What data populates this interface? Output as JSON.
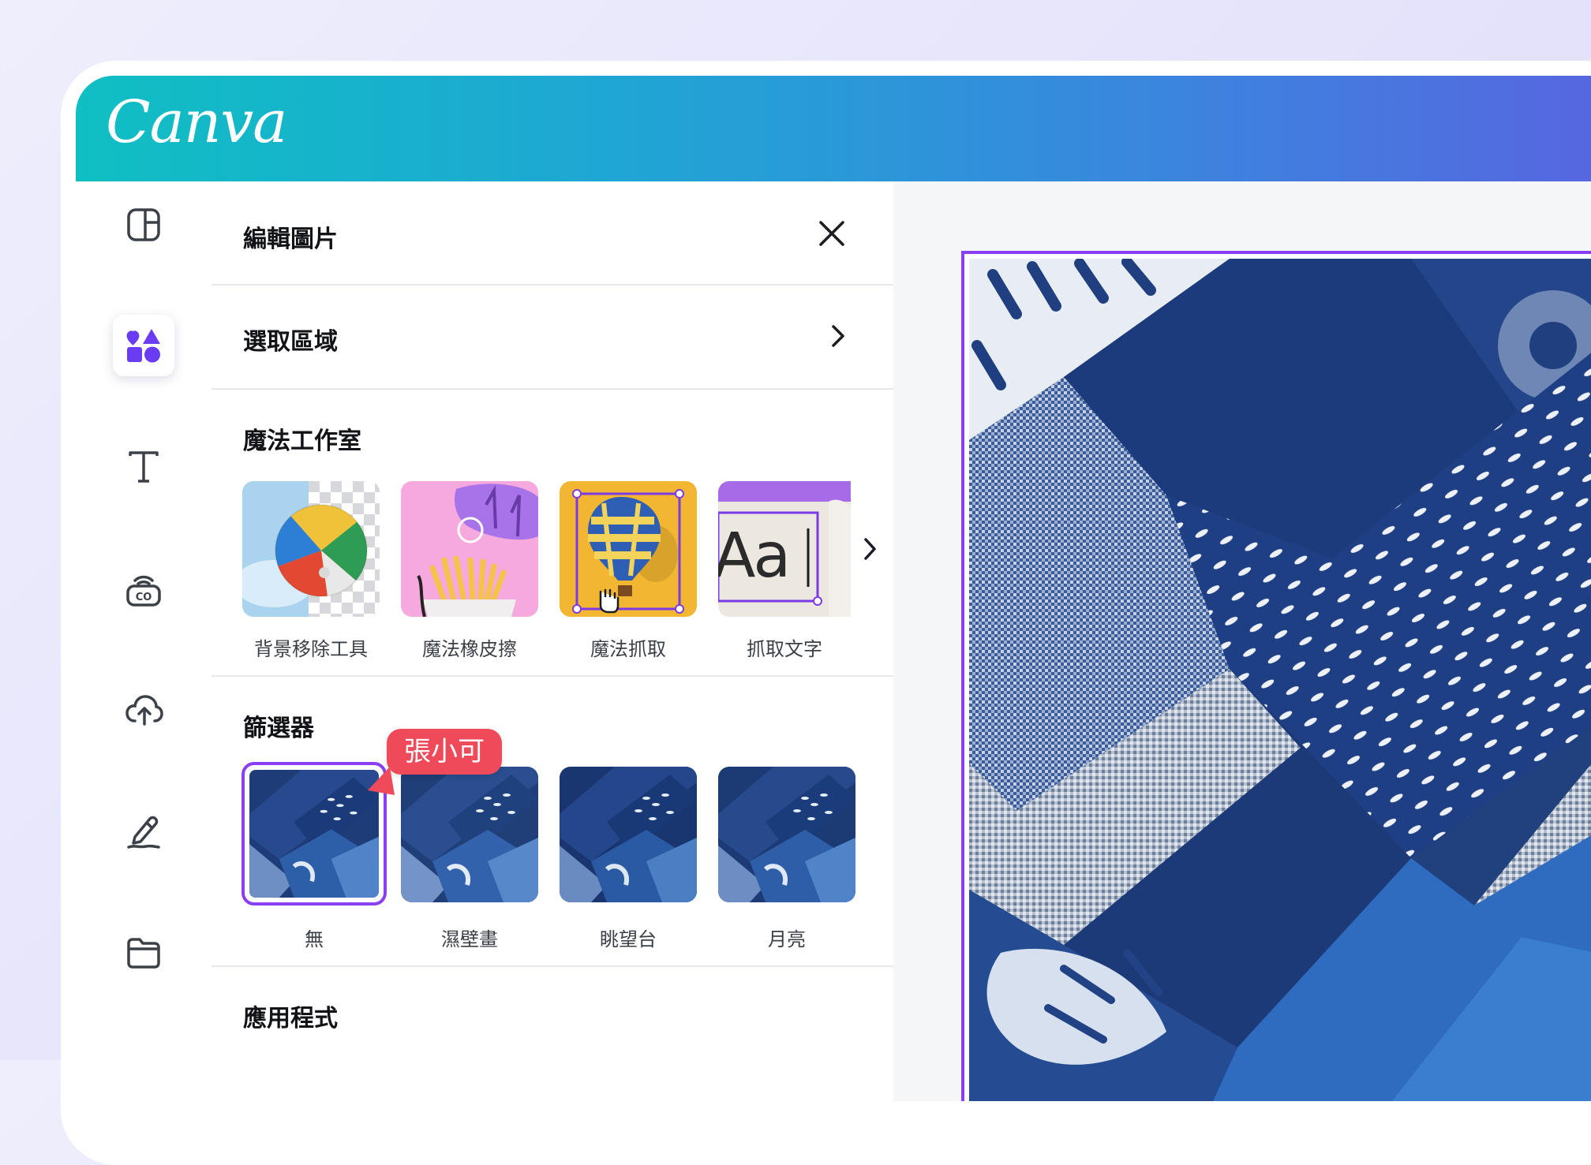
{
  "app": {
    "logo": "Canva"
  },
  "panel": {
    "header_title": "編輯圖片",
    "select_area_label": "選取區域",
    "magic_studio": {
      "title": "魔法工作室",
      "tools": [
        {
          "label": "背景移除工具",
          "icon": "beach-ball-icon"
        },
        {
          "label": "魔法橡皮擦",
          "icon": "fries-icon"
        },
        {
          "label": "魔法抓取",
          "icon": "hot-air-balloon-icon"
        },
        {
          "label": "抓取文字",
          "icon": "text-grab-icon",
          "preview_text": "Aa"
        }
      ]
    },
    "filters": {
      "title": "篩選器",
      "items": [
        {
          "label": "無",
          "selected": true
        },
        {
          "label": "濕壁畫"
        },
        {
          "label": "眺望台"
        },
        {
          "label": "月亮"
        }
      ],
      "collaborator_tag": "張小可"
    },
    "apps_title": "應用程式"
  },
  "sidebar": {
    "items": [
      {
        "icon": "layout-icon"
      },
      {
        "icon": "elements-icon",
        "active": true
      },
      {
        "icon": "text-icon"
      },
      {
        "icon": "brand-icon"
      },
      {
        "icon": "upload-cloud-icon"
      },
      {
        "icon": "draw-icon"
      },
      {
        "icon": "folder-icon"
      }
    ]
  },
  "colors": {
    "selection": "#8a3ff0",
    "collaborator": "#ee4a5a",
    "elements_icon": "#6a3cf3"
  }
}
